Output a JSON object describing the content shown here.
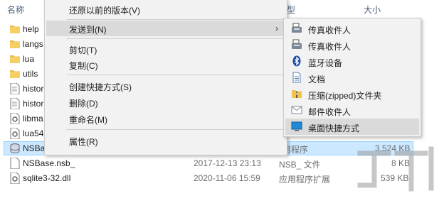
{
  "header": {
    "name": "名称",
    "type": "类型",
    "size": "大小"
  },
  "files": [
    {
      "name": "help",
      "date": "",
      "type": "",
      "size": "",
      "kind": "folder"
    },
    {
      "name": "langs",
      "date": "",
      "type": "",
      "size": "",
      "kind": "folder"
    },
    {
      "name": "lua",
      "date": "",
      "type": "",
      "size": "",
      "kind": "folder"
    },
    {
      "name": "utils",
      "date": "",
      "type": "",
      "size": "",
      "kind": "folder"
    },
    {
      "name": "histor",
      "date": "",
      "type": "",
      "size": "",
      "kind": "doc"
    },
    {
      "name": "histor",
      "date": "",
      "type": "",
      "size": "",
      "kind": "doc"
    },
    {
      "name": "libma",
      "date": "",
      "type": "",
      "size": "",
      "kind": "dll"
    },
    {
      "name": "lua54",
      "date": "",
      "type": "",
      "size": "",
      "kind": "dll"
    },
    {
      "name": "NSBa",
      "date": "",
      "type": "用程序",
      "size": "3,524 KB",
      "kind": "exe",
      "selected": true
    },
    {
      "name": "NSBase.nsb_",
      "date": "2017-12-13 23:13",
      "type": "NSB_ 文件",
      "size": "8 KB",
      "kind": "doc"
    },
    {
      "name": "sqlite3-32.dll",
      "date": "2020-11-06 15:59",
      "type": "应用程序扩展",
      "size": "539 KB",
      "kind": "dll"
    }
  ],
  "context_menu": {
    "items": [
      {
        "label": "还原以前的版本(V)"
      },
      {
        "label": "发送到(N)",
        "submenu": true,
        "hover": true
      },
      {
        "label": "剪切(T)"
      },
      {
        "label": "复制(C)"
      },
      {
        "label": "创建快捷方式(S)"
      },
      {
        "label": "删除(D)"
      },
      {
        "label": "重命名(M)"
      },
      {
        "label": "属性(R)"
      }
    ]
  },
  "send_to_menu": {
    "items": [
      {
        "label": "传真收件人",
        "icon": "fax-icon"
      },
      {
        "label": "传真收件人",
        "icon": "fax-icon"
      },
      {
        "label": "蓝牙设备",
        "icon": "bluetooth-icon"
      },
      {
        "label": "文档",
        "icon": "document-icon"
      },
      {
        "label": "压缩(zipped)文件夹",
        "icon": "zip-folder-icon"
      },
      {
        "label": "邮件收件人",
        "icon": "mail-icon"
      },
      {
        "label": "桌面快捷方式",
        "icon": "desktop-icon",
        "hover": true
      }
    ]
  },
  "colors": {
    "selection": "#cce8ff",
    "menu_bg": "#f2f2f2",
    "hover": "#dadada",
    "bluetooth": "#1b4fa8"
  }
}
